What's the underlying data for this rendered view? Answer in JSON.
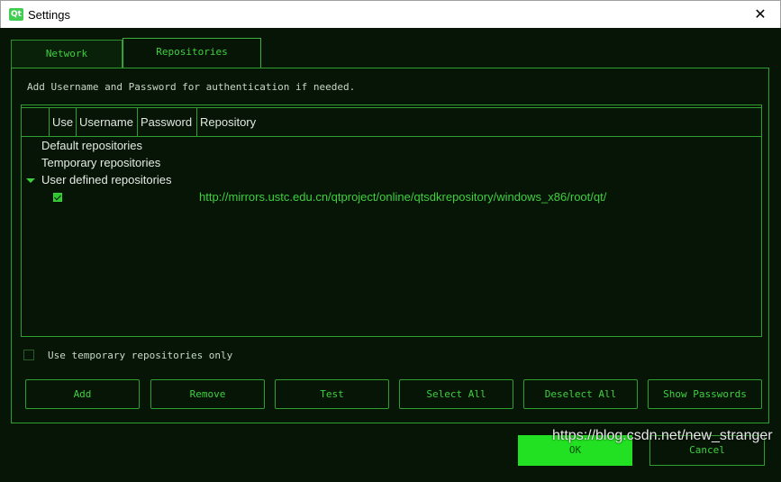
{
  "window": {
    "title": "Settings",
    "logo_text": "Qt",
    "close_glyph": "✕"
  },
  "tabs": [
    {
      "label": "Network",
      "active": false
    },
    {
      "label": "Repositories",
      "active": true
    }
  ],
  "repositories": {
    "hint": "Add Username and Password for authentication if needed.",
    "columns": [
      "",
      "Use",
      "Username",
      "Password",
      "Repository"
    ],
    "groups": [
      {
        "label": "Default repositories"
      },
      {
        "label": "Temporary repositories"
      },
      {
        "label": "User defined repositories",
        "expanded": true
      }
    ],
    "user_repo": {
      "use": true,
      "url": "http://mirrors.ustc.edu.cn/qtproject/online/qtsdkrepository/windows_x86/root/qt/"
    },
    "temp_only_label": "Use temporary repositories only",
    "temp_only_checked": false,
    "buttons": {
      "add": "Add",
      "remove": "Remove",
      "test": "Test",
      "select_all": "Select All",
      "deselect_all": "Deselect All",
      "show_passwords": "Show Passwords"
    }
  },
  "dialog_buttons": {
    "ok": "OK",
    "cancel": "Cancel"
  },
  "watermark": "https://blog.csdn.net/new_stranger",
  "colors": {
    "background": "#061506",
    "accent": "#3fd03f",
    "ok_fill": "#22e022",
    "border": "#2f9f2f"
  },
  "icons": {
    "expander": "triangle-down-icon",
    "check": "checkmark-icon",
    "close": "close-icon",
    "logo": "qt-logo-icon"
  }
}
